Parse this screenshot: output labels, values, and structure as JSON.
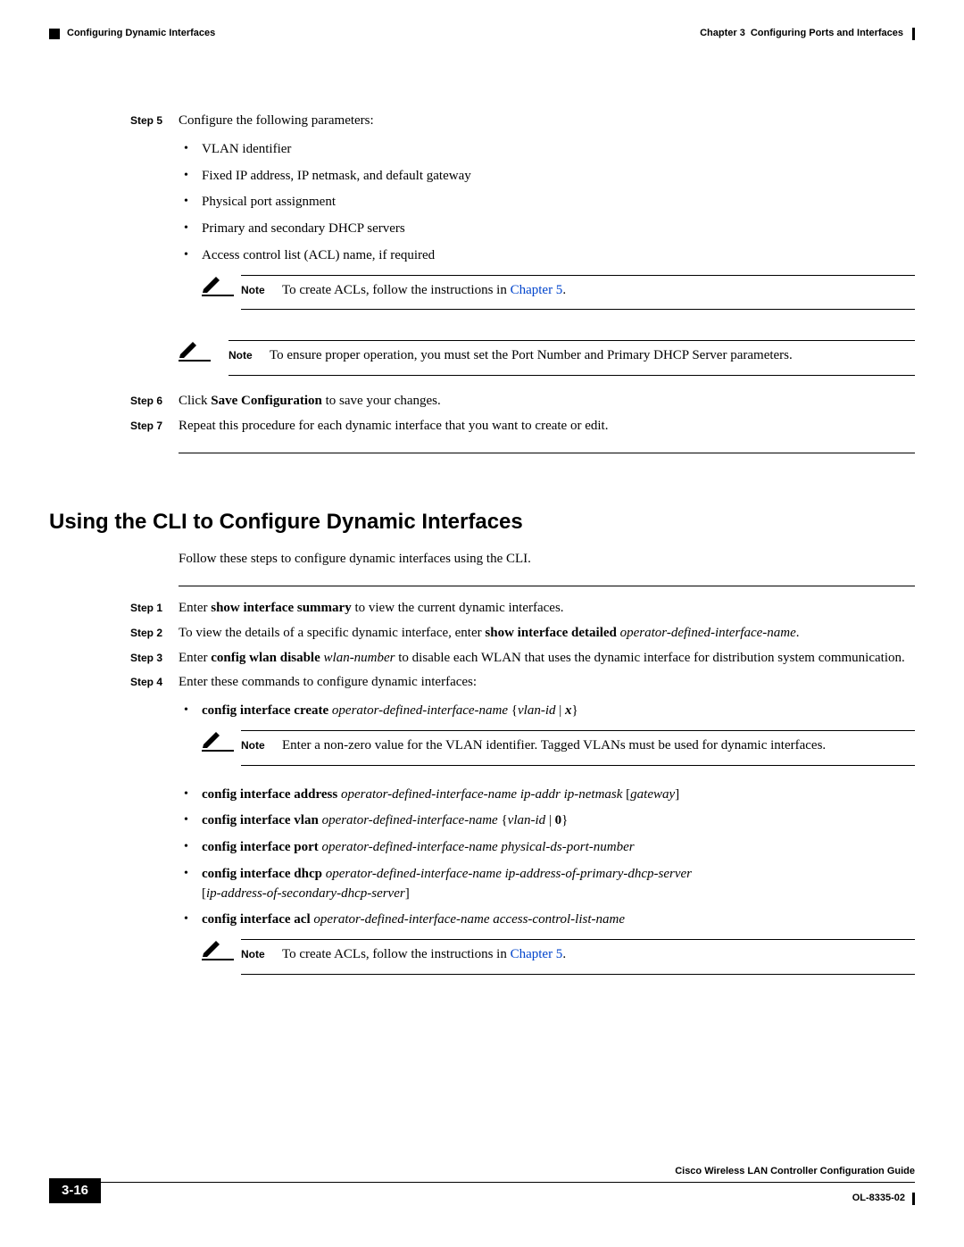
{
  "header": {
    "section_left": "Configuring Dynamic Interfaces",
    "chapter_label": "Chapter 3",
    "chapter_title": "Configuring Ports and Interfaces"
  },
  "section1": {
    "step5": {
      "label": "Step 5",
      "intro": "Configure the following parameters:",
      "bullets": [
        "VLAN identifier",
        "Fixed IP address, IP netmask, and default gateway",
        "Physical port assignment",
        "Primary and secondary DHCP servers",
        "Access control list (ACL) name, if required"
      ],
      "note1": {
        "label": "Note",
        "prefix": "To create ACLs, follow the instructions in ",
        "link": "Chapter 5",
        "suffix": "."
      },
      "note2": {
        "label": "Note",
        "text": "To ensure proper operation, you must set the Port Number and Primary DHCP Server parameters."
      }
    },
    "step6": {
      "label": "Step 6",
      "prefix": "Click ",
      "bold": "Save Configuration",
      "suffix": " to save your changes."
    },
    "step7": {
      "label": "Step 7",
      "text": "Repeat this procedure for each dynamic interface that you want to create or edit."
    }
  },
  "section2": {
    "title": "Using the CLI to Configure Dynamic Interfaces",
    "intro": "Follow these steps to configure dynamic interfaces using the CLI.",
    "step1": {
      "label": "Step 1",
      "prefix": "Enter ",
      "bold": "show interface summary",
      "suffix": " to view the current dynamic interfaces."
    },
    "step2": {
      "label": "Step 2",
      "prefix": "To view the details of a specific dynamic interface, enter ",
      "bold": "show interface detailed",
      "ital": "operator-defined-interface-name",
      "suffix": "."
    },
    "step3": {
      "label": "Step 3",
      "prefix": "Enter ",
      "bold": "config wlan disable",
      "ital": "wlan-number",
      "suffix": " to disable each WLAN that uses the dynamic interface for distribution system communication."
    },
    "step4": {
      "label": "Step 4",
      "intro": "Enter these commands to configure dynamic interfaces:",
      "b1": {
        "cmd": "config interface create",
        "arg1": "operator-defined-interface-name",
        "brace_open": " {",
        "arg2": "vlan-id",
        "pipe": " | ",
        "arg3": "x",
        "brace_close": "}"
      },
      "note_inner": {
        "label": "Note",
        "text": "Enter a non-zero value for the VLAN identifier. Tagged VLANs must be used for dynamic interfaces."
      },
      "b2": {
        "cmd": "config interface address",
        "arg1": "operator-defined-interface-name ip-addr ip-netmask",
        "opt": "gateway"
      },
      "b3": {
        "cmd": "config interface vlan",
        "arg1": "operator-defined-interface-name",
        "brace_open": " {",
        "arg2": "vlan-id",
        "pipe": " | ",
        "zero": "0",
        "brace_close": "}"
      },
      "b4": {
        "cmd": "config interface port",
        "arg1": "operator-defined-interface-name physical-ds-port-number"
      },
      "b5": {
        "cmd": "config interface dhcp",
        "arg1": "operator-defined-interface-name ip-address-of-primary-dhcp-server",
        "opt": "ip-address-of-secondary-dhcp-server"
      },
      "b6": {
        "cmd": "config interface acl",
        "arg1": "operator-defined-interface-name access-control-list-name"
      },
      "note2": {
        "label": "Note",
        "prefix": "To create ACLs, follow the instructions in ",
        "link": "Chapter 5",
        "suffix": "."
      }
    }
  },
  "footer": {
    "guide": "Cisco Wireless LAN Controller Configuration Guide",
    "page": "3-16",
    "docnum": "OL-8335-02"
  }
}
